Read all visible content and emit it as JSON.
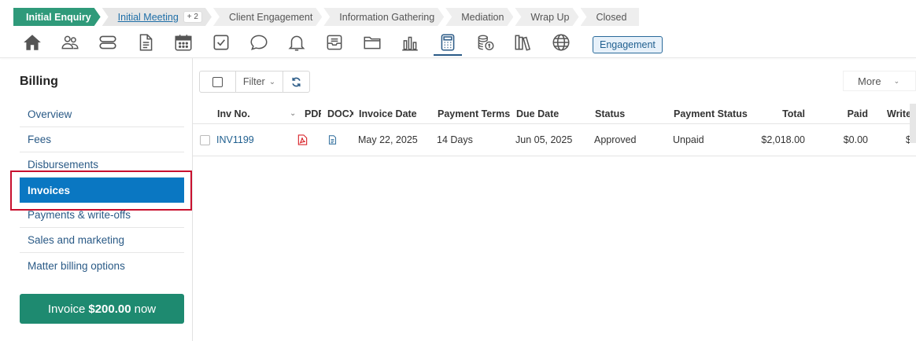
{
  "stages": [
    {
      "label": "Initial Enquiry"
    },
    {
      "label": "Initial Meeting",
      "badge": "+ 2"
    },
    {
      "label": "Client Engagement"
    },
    {
      "label": "Information Gathering"
    },
    {
      "label": "Mediation"
    },
    {
      "label": "Wrap Up"
    },
    {
      "label": "Closed"
    }
  ],
  "iconbar": {
    "icons": [
      "home-icon",
      "people-icon",
      "stack-icon",
      "document-icon",
      "calendar-icon",
      "checkbox-icon",
      "chat-icon",
      "bell-icon",
      "inbox-icon",
      "folder-icon",
      "chart-icon",
      "calculator-icon",
      "coins-icon",
      "books-icon",
      "globe-icon"
    ],
    "active": "calculator-icon",
    "engagement_label": "Engagement"
  },
  "sidebar": {
    "title": "Billing",
    "items": [
      "Overview",
      "Fees",
      "Disbursements",
      "Invoices",
      "Payments & write-offs",
      "Sales and marketing",
      "Matter billing options"
    ],
    "active_item": "Invoices",
    "invoice_button": {
      "prefix": "Invoice",
      "amount": "$200.00",
      "suffix": "now"
    }
  },
  "toolbar": {
    "filter_label": "Filter",
    "filter_chevron": "⌄",
    "more_label": "More",
    "more_chevron": "⌄"
  },
  "table": {
    "headers": {
      "inv_no": "Inv No.",
      "pdf": "PDF",
      "docx": "DOCX",
      "invoice_date": "Invoice Date",
      "payment_terms": "Payment Terms",
      "due_date": "Due Date",
      "status": "Status",
      "payment_status": "Payment Status",
      "total": "Total",
      "paid": "Paid",
      "write": "Write"
    },
    "sort_icon": "⌄",
    "rows": [
      {
        "inv_no": "INV1199",
        "invoice_date": "May 22, 2025",
        "payment_terms": "14 Days",
        "due_date": "Jun 05, 2025",
        "status": "Approved",
        "payment_status": "Unpaid",
        "total": "$2,018.00",
        "paid": "$0.00",
        "write": "$"
      }
    ]
  },
  "colors": {
    "accent_green": "#2f9a7a",
    "button_green": "#1e8a70",
    "active_blue": "#0a77c2",
    "link_blue": "#1f5f8f",
    "highlight_red": "#c8102e",
    "pdf_red": "#d9262c"
  }
}
